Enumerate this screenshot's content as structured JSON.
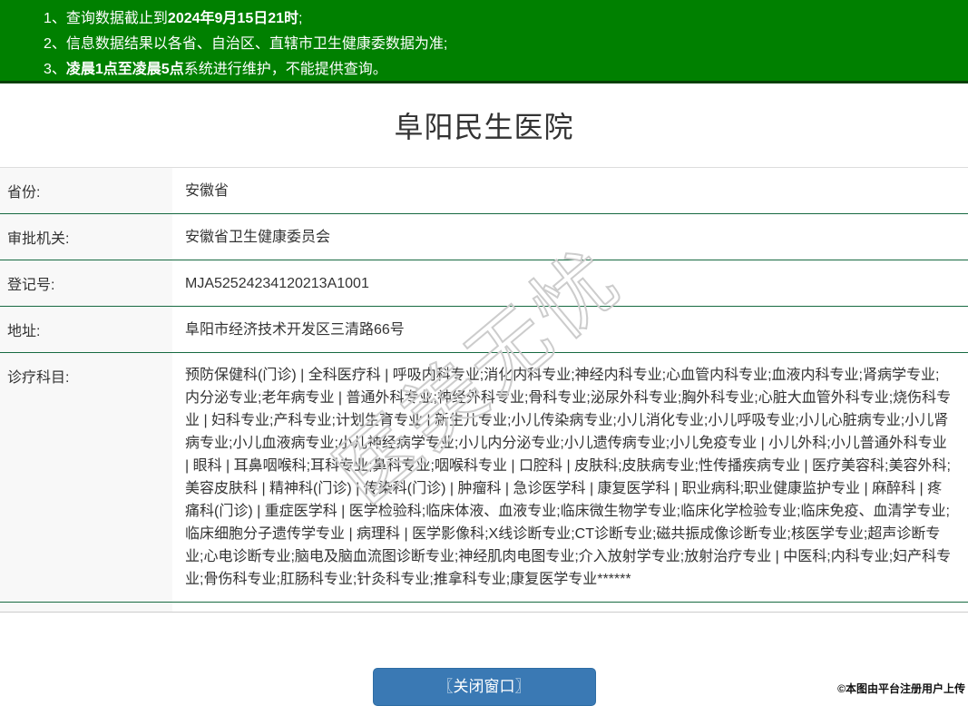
{
  "notices": {
    "items": [
      {
        "num": "1、",
        "pre": "查询数据截止到",
        "bold": "2024年9月15日21时",
        "post": ";"
      },
      {
        "num": "2、",
        "pre": "信息数据结果以各省、自治区、直辖市卫生健康委数据为准;",
        "bold": "",
        "post": ""
      },
      {
        "num": "3、",
        "pre": "",
        "bold": "凌晨1点至凌晨5点",
        "post": "系统进行维护，不能提供查询。"
      }
    ]
  },
  "title": "阜阳民生医院",
  "table": {
    "rows": [
      {
        "label": "省份:",
        "value": "安徽省"
      },
      {
        "label": "审批机关:",
        "value": "安徽省卫生健康委员会"
      },
      {
        "label": "登记号:",
        "value": "MJA52524234120213A1001"
      },
      {
        "label": "地址:",
        "value": "阜阳市经济技术开发区三清路66号"
      },
      {
        "label": "诊疗科目:",
        "value": "预防保健科(门诊) | 全科医疗科 | 呼吸内科专业;消化内科专业;神经内科专业;心血管内科专业;血液内科专业;肾病学专业;内分泌专业;老年病专业 | 普通外科专业;神经外科专业;骨科专业;泌尿外科专业;胸外科专业;心脏大血管外科专业;烧伤科专业 | 妇科专业;产科专业;计划生育专业 | 新生儿专业;小儿传染病专业;小儿消化专业;小儿呼吸专业;小儿心脏病专业;小儿肾病专业;小儿血液病专业;小儿神经病学专业;小儿内分泌专业;小儿遗传病专业;小儿免疫专业 | 小儿外科;小儿普通外科专业 | 眼科 | 耳鼻咽喉科;耳科专业;鼻科专业;咽喉科专业 | 口腔科 | 皮肤科;皮肤病专业;性传播疾病专业 | 医疗美容科;美容外科;美容皮肤科 | 精神科(门诊) | 传染科(门诊) | 肿瘤科 | 急诊医学科 | 康复医学科 | 职业病科;职业健康监护专业 | 麻醉科 | 疼痛科(门诊) | 重症医学科 | 医学检验科;临床体液、血液专业;临床微生物学专业;临床化学检验专业;临床免疫、血清学专业;临床细胞分子遗传学专业 | 病理科 | 医学影像科;X线诊断专业;CT诊断专业;磁共振成像诊断专业;核医学专业;超声诊断专业;心电诊断专业;脑电及脑血流图诊断专业;神经肌肉电图专业;介入放射学专业;放射治疗专业 | 中医科;内科专业;妇产科专业;骨伤科专业;肛肠科专业;针灸科专业;推拿科专业;康复医学专业******"
      }
    ]
  },
  "close_button_label": "〖关闭窗口〗",
  "watermark_text": "医美无忧",
  "footer_note": "©本图由平台注册用户上传",
  "colors": {
    "header_green": "#008000",
    "row_border_green": "#176a41",
    "button_blue": "#3a79b4"
  }
}
